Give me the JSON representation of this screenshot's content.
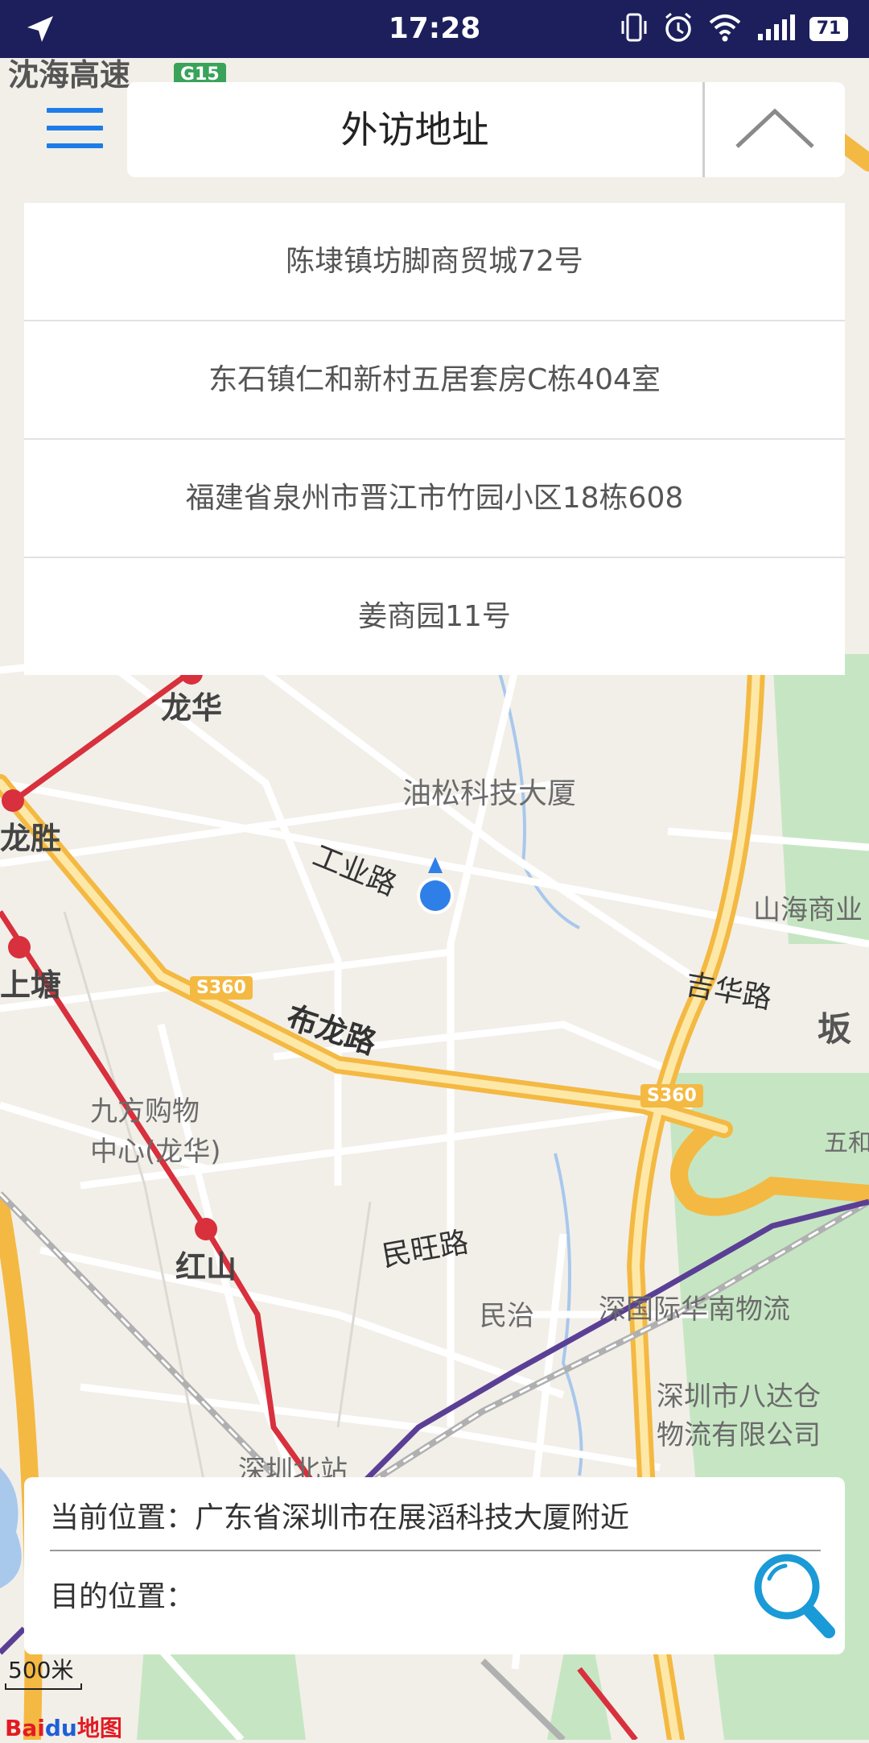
{
  "status_bar": {
    "time": "17:28",
    "battery": "71",
    "icons": [
      "location-arrow-icon",
      "vibrate-icon",
      "alarm-icon",
      "wifi-icon",
      "signal-icon",
      "battery-icon"
    ]
  },
  "header": {
    "title": "外访地址",
    "menu_icon": "hamburger-menu-icon",
    "collapse_icon": "chevron-up-icon"
  },
  "address_list": [
    "陈埭镇坊脚商贸城72号",
    "东石镇仁和新村五居套房C栋404室",
    "福建省泉州市晋江市竹园小区18栋608",
    "姜商园11号"
  ],
  "map": {
    "labels": {
      "expressway": "沈海高速",
      "g15": "G15",
      "longhua": "龙华",
      "longsheng": "龙胜",
      "shangtang": "上塘",
      "youfeng": "油松科技大厦",
      "gongye_road": "工业路",
      "bulong_road": "布龙路",
      "s360_a": "S360",
      "s360_b": "S360",
      "jihua_road": "吉华路",
      "shanhai": "山海商业",
      "ban": "坂",
      "jiufang": "九方购物",
      "jiufang2": "中心(龙华)",
      "hongshan": "红山",
      "minwang_road": "民旺路",
      "minzhi": "民治",
      "shenguoji": "深国际华南物流",
      "bada1": "深圳市八达仓",
      "bada2": "物流有限公司",
      "north_station": "深圳北站",
      "wuhe": "五和"
    },
    "colors": {
      "background": "#f2efe9",
      "green": "#c6e6c3",
      "yellow_road": "#f7c85c",
      "metro_red": "#d8303c",
      "metro_purple": "#5b3f95",
      "marker_blue": "#2f7fe8"
    }
  },
  "bottom_panel": {
    "current_location": "当前位置：广东省深圳市在展滔科技大厦附近",
    "destination_label": "目的位置：",
    "search_icon": "search-icon"
  },
  "scale": "500米",
  "logo": {
    "red": "Bai",
    "blue": "du",
    "tail": "地图"
  }
}
